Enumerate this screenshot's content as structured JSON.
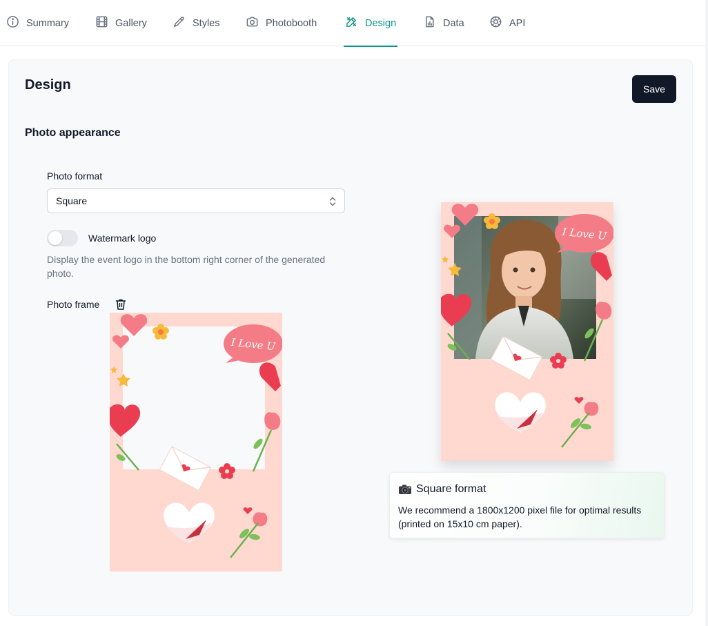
{
  "tabs": [
    {
      "label": "Summary",
      "icon": "info-circle-icon",
      "active": false
    },
    {
      "label": "Gallery",
      "icon": "film-icon",
      "active": false
    },
    {
      "label": "Styles",
      "icon": "eyedropper-icon",
      "active": false
    },
    {
      "label": "Photobooth",
      "icon": "camera-icon",
      "active": false
    },
    {
      "label": "Design",
      "icon": "design-tools-icon",
      "active": true
    },
    {
      "label": "Data",
      "icon": "chart-file-icon",
      "active": false
    },
    {
      "label": "API",
      "icon": "gear-icon",
      "active": false
    }
  ],
  "page": {
    "title": "Design",
    "save_label": "Save"
  },
  "section": {
    "title": "Photo appearance"
  },
  "photo_format": {
    "label": "Photo format",
    "value": "Square"
  },
  "watermark": {
    "label": "Watermark logo",
    "enabled": false,
    "helper": "Display the event logo in the bottom right corner of the generated photo."
  },
  "photo_frame": {
    "label": "Photo frame",
    "bubble_text": "I Love U"
  },
  "info": {
    "title": "Square format",
    "text": "We recommend a 1800x1200 pixel file for optimal results (printed on 15x10 cm paper)."
  },
  "colors": {
    "accent": "#0f9488",
    "frame_bg": "#ffd9cf",
    "heart": "#f3545f",
    "save_bg": "#111827"
  }
}
